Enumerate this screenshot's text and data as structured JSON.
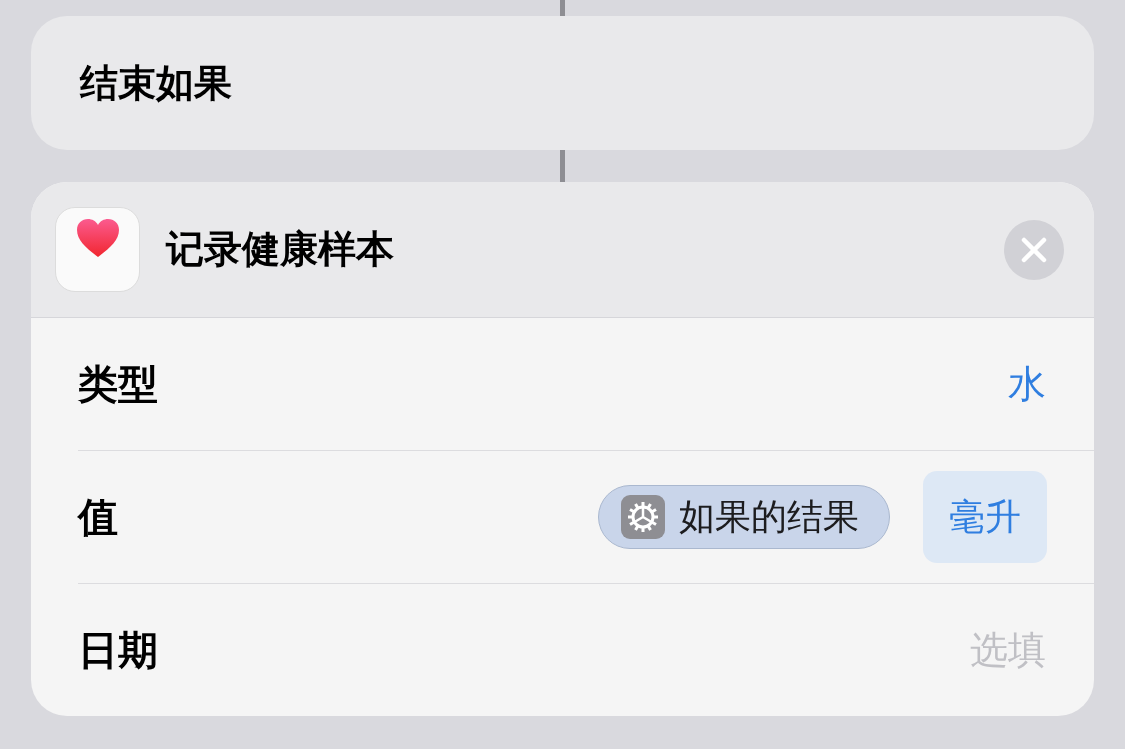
{
  "end_if": {
    "label": "结束如果"
  },
  "action": {
    "title": "记录健康样本",
    "rows": [
      {
        "kind": "value",
        "label": "类型",
        "value": "水"
      },
      {
        "kind": "token",
        "label": "值",
        "token": "如果的结果",
        "unit": "毫升"
      },
      {
        "kind": "placeholder",
        "label": "日期",
        "placeholder": "选填"
      }
    ]
  }
}
